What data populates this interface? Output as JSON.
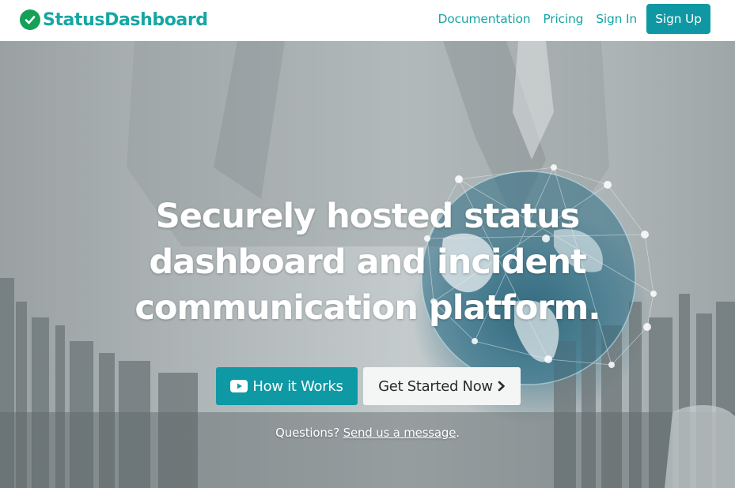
{
  "brand": {
    "name": "StatusDashboard",
    "icon": "check-circle-icon",
    "icon_color": "#15a05a",
    "text_color": "#16a6a4"
  },
  "nav": {
    "links": [
      "Documentation",
      "Pricing",
      "Sign In"
    ],
    "signup_label": "Sign Up",
    "accent": "#0f98a3"
  },
  "hero": {
    "headline_lines": [
      "Securely hosted status",
      "dashboard and incident",
      "communication platform."
    ],
    "how_label": "How it Works",
    "how_icon": "youtube-play-icon",
    "start_label": "Get Started Now",
    "start_icon": "chevron-right-icon",
    "questions_text": "Questions?",
    "message_link": "Send us a message",
    "period": "."
  }
}
